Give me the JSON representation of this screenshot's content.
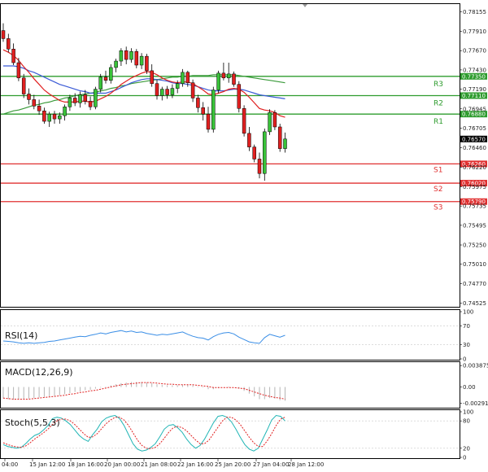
{
  "chart_data": {
    "type": "candlestick",
    "main": {
      "price_ticks": [
        "0.78155",
        "0.77910",
        "0.77670",
        "0.77430",
        "0.77190",
        "0.76945",
        "0.76705",
        "0.76460",
        "0.76220",
        "0.75975",
        "0.75735",
        "0.75495",
        "0.75250",
        "0.75010",
        "0.74770",
        "0.74525"
      ],
      "levels": [
        {
          "name": "R3",
          "value": "0.77350",
          "color": "#2e9c2e"
        },
        {
          "name": "R2",
          "value": "0.77110",
          "color": "#2e9c2e"
        },
        {
          "name": "R1",
          "value": "0.76880",
          "color": "#2e9c2e"
        },
        {
          "name": "S1",
          "value": "0.76260",
          "color": "#e03030"
        },
        {
          "name": "S2",
          "value": "0.76020",
          "color": "#e03030"
        },
        {
          "name": "S3",
          "value": "0.75790",
          "color": "#e03030"
        }
      ],
      "current_price": "0.76570",
      "candles": [
        {
          "o": 0.7792,
          "h": 0.7801,
          "l": 0.7778,
          "c": 0.7782
        },
        {
          "o": 0.7782,
          "h": 0.7788,
          "l": 0.7765,
          "c": 0.7769
        },
        {
          "o": 0.7769,
          "h": 0.7776,
          "l": 0.7749,
          "c": 0.7752
        },
        {
          "o": 0.7752,
          "h": 0.7758,
          "l": 0.7729,
          "c": 0.7733
        },
        {
          "o": 0.7733,
          "h": 0.7738,
          "l": 0.7708,
          "c": 0.7713
        },
        {
          "o": 0.7713,
          "h": 0.772,
          "l": 0.77,
          "c": 0.7706
        },
        {
          "o": 0.7706,
          "h": 0.7712,
          "l": 0.7694,
          "c": 0.7698
        },
        {
          "o": 0.7698,
          "h": 0.7706,
          "l": 0.7687,
          "c": 0.7692
        },
        {
          "o": 0.7692,
          "h": 0.7696,
          "l": 0.7676,
          "c": 0.7679
        },
        {
          "o": 0.7679,
          "h": 0.7691,
          "l": 0.7672,
          "c": 0.7688
        },
        {
          "o": 0.7688,
          "h": 0.7692,
          "l": 0.7676,
          "c": 0.7682
        },
        {
          "o": 0.7682,
          "h": 0.769,
          "l": 0.7676,
          "c": 0.7686
        },
        {
          "o": 0.7686,
          "h": 0.77,
          "l": 0.768,
          "c": 0.7697
        },
        {
          "o": 0.7697,
          "h": 0.7712,
          "l": 0.7692,
          "c": 0.7708
        },
        {
          "o": 0.7708,
          "h": 0.7714,
          "l": 0.7698,
          "c": 0.7702
        },
        {
          "o": 0.7702,
          "h": 0.7716,
          "l": 0.7696,
          "c": 0.7712
        },
        {
          "o": 0.7712,
          "h": 0.7718,
          "l": 0.77,
          "c": 0.7704
        },
        {
          "o": 0.7704,
          "h": 0.771,
          "l": 0.7693,
          "c": 0.7697
        },
        {
          "o": 0.7697,
          "h": 0.7722,
          "l": 0.7694,
          "c": 0.7719
        },
        {
          "o": 0.7719,
          "h": 0.7738,
          "l": 0.7715,
          "c": 0.7734
        },
        {
          "o": 0.7734,
          "h": 0.7742,
          "l": 0.7726,
          "c": 0.773
        },
        {
          "o": 0.773,
          "h": 0.775,
          "l": 0.7726,
          "c": 0.7746
        },
        {
          "o": 0.7746,
          "h": 0.7757,
          "l": 0.774,
          "c": 0.7754
        },
        {
          "o": 0.7754,
          "h": 0.777,
          "l": 0.7748,
          "c": 0.7767
        },
        {
          "o": 0.7767,
          "h": 0.7772,
          "l": 0.775,
          "c": 0.7756
        },
        {
          "o": 0.7756,
          "h": 0.777,
          "l": 0.7752,
          "c": 0.7766
        },
        {
          "o": 0.7766,
          "h": 0.7769,
          "l": 0.7745,
          "c": 0.7749
        },
        {
          "o": 0.7749,
          "h": 0.7764,
          "l": 0.7744,
          "c": 0.776
        },
        {
          "o": 0.776,
          "h": 0.7763,
          "l": 0.7738,
          "c": 0.7742
        },
        {
          "o": 0.7742,
          "h": 0.775,
          "l": 0.7722,
          "c": 0.7726
        },
        {
          "o": 0.7726,
          "h": 0.7731,
          "l": 0.7706,
          "c": 0.7711
        },
        {
          "o": 0.7711,
          "h": 0.7722,
          "l": 0.7705,
          "c": 0.7719
        },
        {
          "o": 0.7719,
          "h": 0.7723,
          "l": 0.7707,
          "c": 0.7712
        },
        {
          "o": 0.7712,
          "h": 0.7725,
          "l": 0.7708,
          "c": 0.772
        },
        {
          "o": 0.772,
          "h": 0.773,
          "l": 0.7714,
          "c": 0.7726
        },
        {
          "o": 0.7726,
          "h": 0.7744,
          "l": 0.7722,
          "c": 0.774
        },
        {
          "o": 0.774,
          "h": 0.7742,
          "l": 0.7722,
          "c": 0.7727
        },
        {
          "o": 0.7727,
          "h": 0.7731,
          "l": 0.7703,
          "c": 0.7708
        },
        {
          "o": 0.7708,
          "h": 0.7712,
          "l": 0.769,
          "c": 0.7696
        },
        {
          "o": 0.7696,
          "h": 0.7703,
          "l": 0.768,
          "c": 0.7688
        },
        {
          "o": 0.7688,
          "h": 0.7697,
          "l": 0.7665,
          "c": 0.7669
        },
        {
          "o": 0.7669,
          "h": 0.7722,
          "l": 0.7665,
          "c": 0.7718
        },
        {
          "o": 0.7718,
          "h": 0.7742,
          "l": 0.7714,
          "c": 0.7739
        },
        {
          "o": 0.7739,
          "h": 0.7752,
          "l": 0.773,
          "c": 0.7733
        },
        {
          "o": 0.7733,
          "h": 0.7752,
          "l": 0.7727,
          "c": 0.7738
        },
        {
          "o": 0.7738,
          "h": 0.7741,
          "l": 0.7722,
          "c": 0.7725
        },
        {
          "o": 0.7725,
          "h": 0.7729,
          "l": 0.769,
          "c": 0.7695
        },
        {
          "o": 0.7695,
          "h": 0.7699,
          "l": 0.766,
          "c": 0.7664
        },
        {
          "o": 0.7664,
          "h": 0.7672,
          "l": 0.7642,
          "c": 0.7647
        },
        {
          "o": 0.7647,
          "h": 0.765,
          "l": 0.7628,
          "c": 0.7632
        },
        {
          "o": 0.7632,
          "h": 0.764,
          "l": 0.7608,
          "c": 0.7614
        },
        {
          "o": 0.7614,
          "h": 0.767,
          "l": 0.7605,
          "c": 0.7666
        },
        {
          "o": 0.7666,
          "h": 0.7694,
          "l": 0.7662,
          "c": 0.769
        },
        {
          "o": 0.769,
          "h": 0.7693,
          "l": 0.7668,
          "c": 0.7672
        },
        {
          "o": 0.7672,
          "h": 0.7676,
          "l": 0.7641,
          "c": 0.7645
        },
        {
          "o": 0.7645,
          "h": 0.7665,
          "l": 0.764,
          "c": 0.7657
        }
      ],
      "ma_red": [
        0.7768,
        0.7765,
        0.7761,
        0.7755,
        0.7747,
        0.774,
        0.7732,
        0.7725,
        0.7718,
        0.7713,
        0.7709,
        0.7705,
        0.7703,
        0.7703,
        0.7703,
        0.7704,
        0.7704,
        0.7703,
        0.7704,
        0.7707,
        0.771,
        0.7714,
        0.7719,
        0.7725,
        0.7729,
        0.7733,
        0.7736,
        0.7739,
        0.7741,
        0.774,
        0.7737,
        0.7733,
        0.773,
        0.7728,
        0.7727,
        0.7728,
        0.7728,
        0.7726,
        0.7722,
        0.7718,
        0.7713,
        0.7712,
        0.7714,
        0.7716,
        0.7719,
        0.772,
        0.7719,
        0.7715,
        0.7709,
        0.7702,
        0.7695,
        0.7693,
        0.7692,
        0.769,
        0.7686,
        0.7684
      ],
      "ma_blue": [
        0.7748,
        0.7748,
        0.7748,
        0.7747,
        0.7745,
        0.7742,
        0.774,
        0.7737,
        0.7734,
        0.7731,
        0.7728,
        0.7725,
        0.7723,
        0.7721,
        0.7719,
        0.7717,
        0.7716,
        0.7714,
        0.7714,
        0.7714,
        0.7714,
        0.7716,
        0.7718,
        0.7721,
        0.7724,
        0.7727,
        0.7729,
        0.7731,
        0.7732,
        0.7732,
        0.7731,
        0.773,
        0.7729,
        0.7727,
        0.7726,
        0.7726,
        0.7725,
        0.7724,
        0.7722,
        0.772,
        0.7718,
        0.7717,
        0.7717,
        0.7717,
        0.7718,
        0.7719,
        0.7719,
        0.7718,
        0.7716,
        0.7714,
        0.7712,
        0.7711,
        0.771,
        0.7709,
        0.7708,
        0.7707
      ],
      "ma_green": [
        0.7688,
        0.769,
        0.7692,
        0.7693,
        0.7695,
        0.7697,
        0.7699,
        0.77,
        0.7702,
        0.7703,
        0.7705,
        0.7706,
        0.7708,
        0.7709,
        0.7711,
        0.7712,
        0.7713,
        0.7714,
        0.7715,
        0.7717,
        0.7718,
        0.772,
        0.7721,
        0.7723,
        0.7724,
        0.7726,
        0.7727,
        0.7728,
        0.7729,
        0.773,
        0.7731,
        0.7732,
        0.7733,
        0.7734,
        0.7734,
        0.7735,
        0.7735,
        0.7736,
        0.7736,
        0.7736,
        0.7736,
        0.7737,
        0.7737,
        0.7737,
        0.7737,
        0.7737,
        0.7736,
        0.7735,
        0.7734,
        0.7733,
        0.7732,
        0.7731,
        0.773,
        0.7729,
        0.7728,
        0.7727
      ],
      "ylim": [
        0.7448,
        0.7825
      ]
    },
    "rsi": {
      "label": "RSI(14)",
      "ticks": [
        "100",
        "70",
        "30",
        "0"
      ],
      "ylim": [
        0,
        100
      ],
      "values": [
        38,
        37,
        36,
        34,
        33,
        34,
        33,
        34,
        35,
        37,
        38,
        40,
        42,
        44,
        46,
        48,
        47,
        50,
        52,
        55,
        53,
        56,
        58,
        60,
        57,
        59,
        56,
        57,
        54,
        52,
        50,
        52,
        51,
        53,
        55,
        57,
        52,
        48,
        45,
        44,
        40,
        47,
        52,
        55,
        56,
        53,
        46,
        41,
        36,
        34,
        33,
        45,
        52,
        49,
        46,
        50
      ]
    },
    "macd": {
      "label": "MACD(12,26,9)",
      "ticks": [
        "0.003875",
        "0.00",
        "-0.002911"
      ],
      "ylim": [
        -0.0036,
        0.0042
      ],
      "histogram": [
        -0.0021,
        -0.0022,
        -0.0023,
        -0.0023,
        -0.0022,
        -0.0021,
        -0.002,
        -0.0019,
        -0.0018,
        -0.0017,
        -0.0016,
        -0.0015,
        -0.0013,
        -0.0011,
        -0.0009,
        -0.0008,
        -0.0006,
        -0.0005,
        -0.0003,
        -0.0001,
        0.0001,
        0.0003,
        0.0005,
        0.0007,
        0.0008,
        0.0009,
        0.0009,
        0.0009,
        0.0008,
        0.0007,
        0.0005,
        0.0004,
        0.0003,
        0.0003,
        0.0003,
        0.0004,
        0.0004,
        0.0003,
        0.0001,
        -0.0001,
        -0.0004,
        -0.0004,
        -0.0002,
        0.0,
        0.0001,
        0.0,
        -0.0003,
        -0.0007,
        -0.0012,
        -0.0017,
        -0.0022,
        -0.0022,
        -0.002,
        -0.0021,
        -0.0024,
        -0.0025
      ],
      "signal": [
        -0.002,
        -0.0021,
        -0.0022,
        -0.0022,
        -0.0022,
        -0.0022,
        -0.0021,
        -0.002,
        -0.0019,
        -0.0018,
        -0.0017,
        -0.0016,
        -0.0015,
        -0.0013,
        -0.0012,
        -0.001,
        -0.0009,
        -0.0007,
        -0.0006,
        -0.0004,
        -0.0002,
        0.0,
        0.0002,
        0.0004,
        0.0005,
        0.0006,
        0.0007,
        0.0008,
        0.0008,
        0.0008,
        0.0007,
        0.0006,
        0.0005,
        0.0005,
        0.0004,
        0.0004,
        0.0004,
        0.0004,
        0.0003,
        0.0002,
        0.0001,
        -0.0001,
        -0.0001,
        -0.0001,
        -0.0001,
        -0.0001,
        -0.0002,
        -0.0003,
        -0.0006,
        -0.0009,
        -0.0012,
        -0.0015,
        -0.0017,
        -0.0019,
        -0.002,
        -0.0022
      ]
    },
    "stoch": {
      "label": "Stoch(5,5,3)",
      "ticks": [
        "100",
        "80",
        "20",
        "0"
      ],
      "ylim": [
        0,
        100
      ],
      "main": [
        28,
        24,
        22,
        20,
        22,
        30,
        40,
        48,
        52,
        60,
        70,
        85,
        88,
        86,
        80,
        72,
        60,
        48,
        40,
        35,
        50,
        62,
        78,
        86,
        90,
        92,
        85,
        70,
        50,
        30,
        18,
        14,
        16,
        22,
        30,
        45,
        62,
        70,
        72,
        65,
        55,
        40,
        28,
        20,
        26,
        40,
        58,
        76,
        90,
        92,
        88,
        78,
        62,
        44,
        28,
        18,
        14,
        20,
        40,
        60,
        82,
        92,
        90,
        80
      ],
      "signal": [
        32,
        28,
        25,
        23,
        22,
        25,
        32,
        40,
        47,
        54,
        62,
        72,
        80,
        84,
        84,
        80,
        72,
        62,
        52,
        44,
        45,
        52,
        63,
        74,
        82,
        88,
        88,
        82,
        70,
        54,
        38,
        26,
        20,
        19,
        22,
        30,
        42,
        55,
        65,
        68,
        65,
        58,
        48,
        38,
        30,
        30,
        38,
        52,
        66,
        80,
        88,
        88,
        82,
        72,
        58,
        44,
        32,
        24,
        24,
        36,
        52,
        70,
        84,
        88
      ]
    },
    "x_ticks": [
      "04:00",
      "15 Jan 12:00",
      "18 Jan 16:00",
      "20 Jan 00:00",
      "21 Jan 08:00",
      "22 Jan 16:00",
      "25 Jan 20:00",
      "27 Jan 04:00",
      "28 Jan 12:00"
    ]
  }
}
